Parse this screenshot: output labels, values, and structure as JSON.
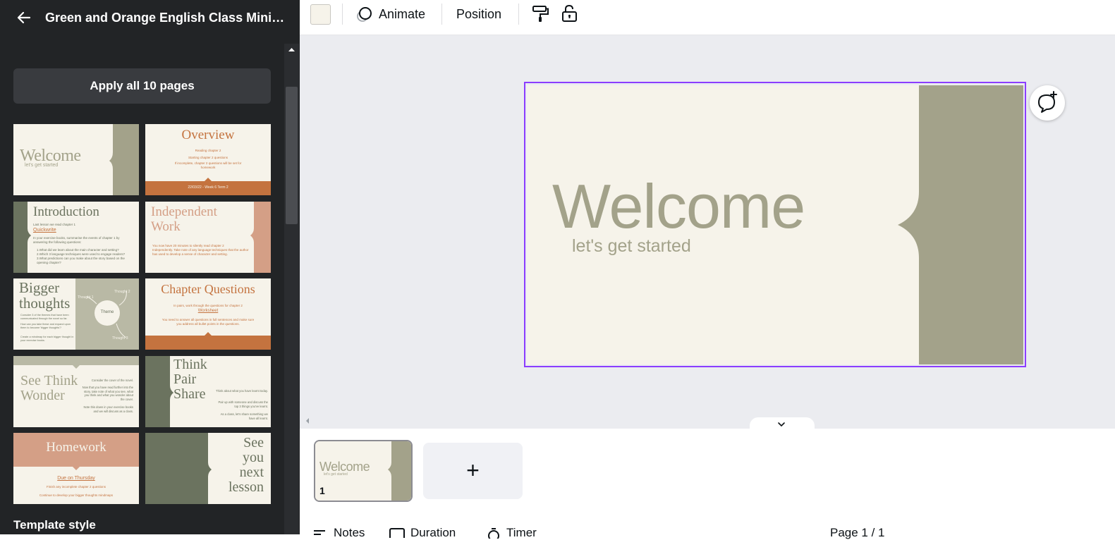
{
  "sidebar": {
    "title": "Green and Orange English Class Minim...",
    "apply_label": "Apply all 10 pages",
    "section_title": "Template style",
    "thumbs": [
      {
        "title": "Welcome",
        "sub": "let's get started"
      },
      {
        "title": "Overview",
        "lines": [
          "Reading chapter 2",
          "Starting chapter 2 questions",
          "If incomplete, chapter 2 questions will be set for homework"
        ],
        "footer": "22/03/22 - Week 6 Term 2"
      },
      {
        "title": "Introduction",
        "sub": "Last lesson we read chapter 1",
        "link": "Quickwrite",
        "lines": [
          "In your exercise books, summarise the events of chapter 1 by answering the following questions:",
          "1.What did we learn about the main character and setting?",
          "2.Which 3 language techniques were used to engage readers?",
          "3.What predictions can you make about the story based on the opening chapter?"
        ]
      },
      {
        "title": "Independent Work",
        "lines": [
          "You now have 20 minutes to silently read chapter 2",
          "Independently. Take note of any language techniques that the author has used to develop a sense of character and setting."
        ]
      },
      {
        "title": "Bigger thoughts",
        "bubble": "Theme",
        "labels": [
          "Thought 1",
          "Thought 2",
          "Thought 3"
        ],
        "lines": [
          "Consider 3 of the themes that have been communicated through the novel so far.",
          "How can you take these and expand upon them to become 'bigger thoughts'?",
          "Create a mindmap for each bigger thought in your exercise books."
        ]
      },
      {
        "title": "Chapter Questions",
        "sub": "In pairs, work through the questions for chapter 2",
        "link": "Worksheet",
        "lines": [
          "You need to answer all questions in full sentences and make sure you address all bullet points in the questions."
        ]
      },
      {
        "title": "See Think Wonder",
        "lines": [
          "Consider the cover of the novel.",
          "Now that you have read further into the story, take note of what you see, what you think and what you wonder about the cover.",
          "Note this down in your exercise books and we will discuss as a class."
        ]
      },
      {
        "title": "Think Pair Share",
        "lines": [
          "Think about what you have learnt today.",
          "Pair up with someone and discuss the top 3 things you've learnt.",
          "As a class, let's share something we have all learnt."
        ]
      },
      {
        "title": "Homework",
        "link": "Due on Thursday",
        "lines": [
          "Finish any incomplete chapter 2 questions",
          "Continue to develop your bigger thoughts mindmaps"
        ]
      },
      {
        "title": "See you next lesson"
      }
    ]
  },
  "toolbar": {
    "swatch_color": "#f6f3ea",
    "animate_label": "Animate",
    "position_label": "Position",
    "icons": [
      "paint-roller-icon",
      "lock-icon"
    ]
  },
  "slide": {
    "title": "Welcome",
    "subtitle": "let's get started",
    "bg_color": "#f6f3ea",
    "panel_color": "#a3a28a",
    "text_color": "#a3a28a"
  },
  "pages": {
    "current_page_number": "1",
    "add_label": "+",
    "thumb_title": "Welcome",
    "thumb_sub": "let's get started"
  },
  "bottombar": {
    "notes_label": "Notes",
    "duration_label": "Duration",
    "timer_label": "Timer",
    "page_label": "Page 1 / 1"
  },
  "colors": {
    "accent": "#8b3dff",
    "sidebar_bg": "#222426",
    "canvas_bg": "#ebecf0",
    "olive": "#a3a28a",
    "orange": "#c4733f",
    "peach": "#d49f86",
    "dark_green": "#6b735f"
  }
}
